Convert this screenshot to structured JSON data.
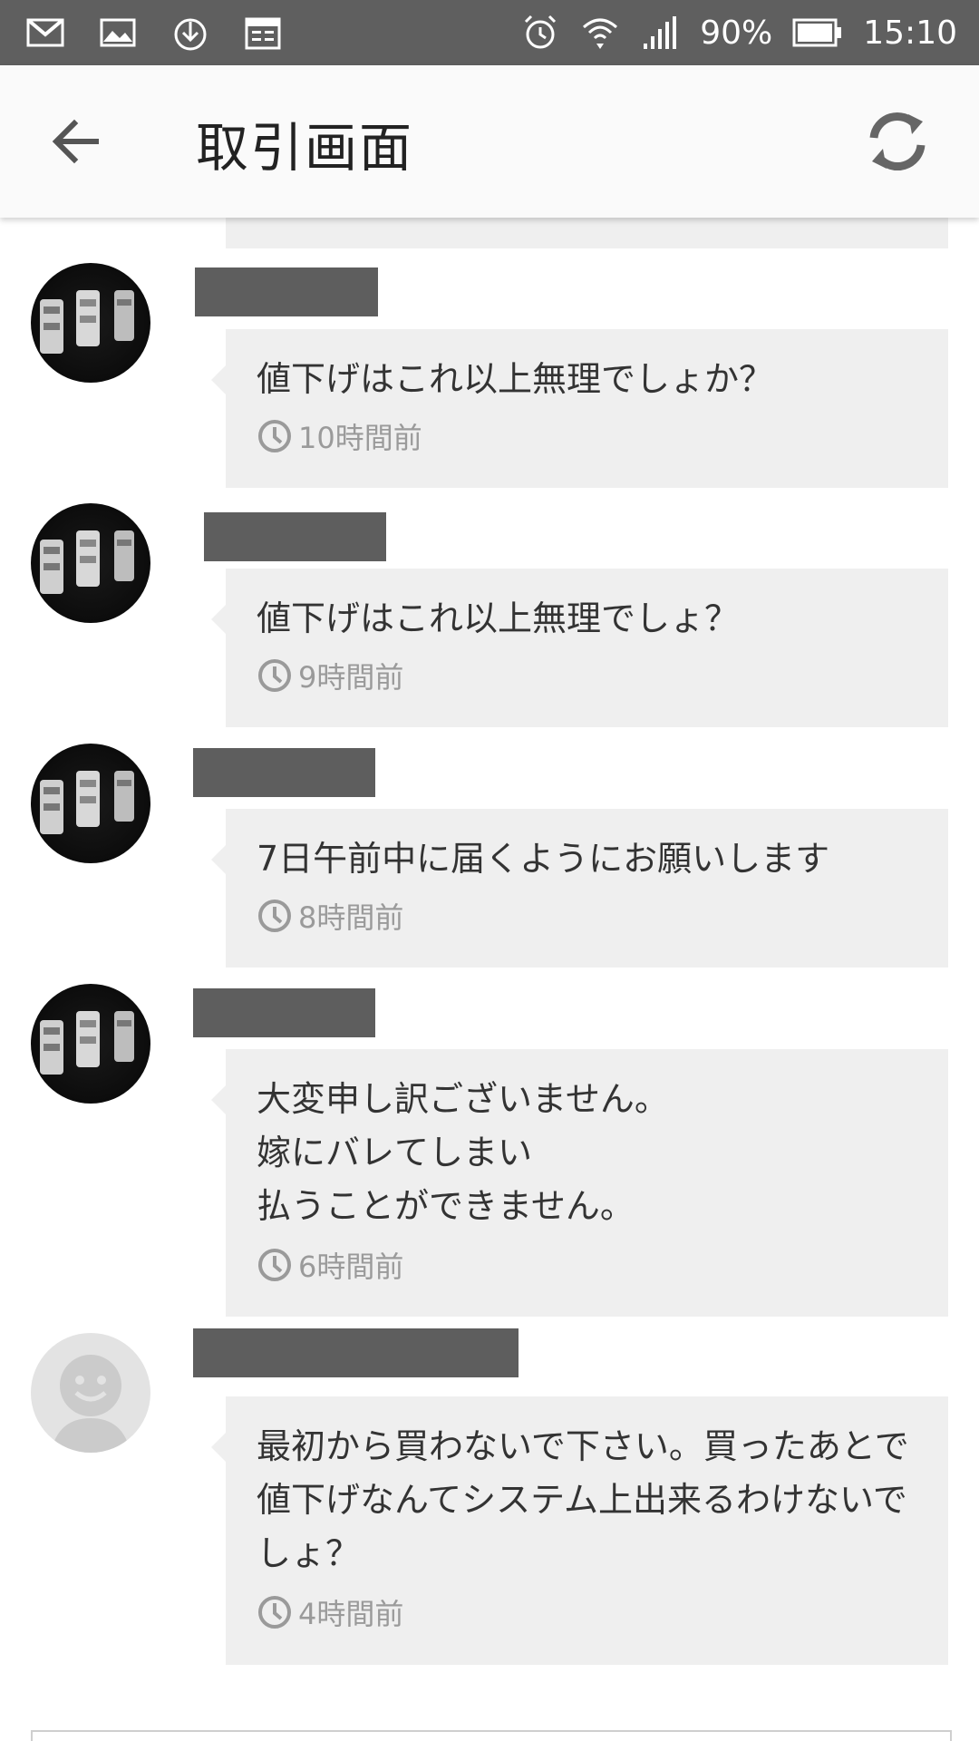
{
  "status_bar": {
    "battery": "90%",
    "time": "15:10",
    "left_icons": [
      "gmail-icon",
      "gallery-icon",
      "download-icon",
      "calendar-icon"
    ],
    "right_icons": [
      "alarm-icon",
      "wifi-icon",
      "signal-icon",
      "battery-icon"
    ]
  },
  "app_bar": {
    "title": "取引画面",
    "back_icon": "arrow-left-icon",
    "refresh_icon": "refresh-icon"
  },
  "messages": [
    {
      "text": "値下げはこれ以上無理でしょか？",
      "time": "10時間前",
      "avatar": "product-photo"
    },
    {
      "text": "値下げはこれ以上無理でしょ？",
      "time": "9時間前",
      "avatar": "product-photo"
    },
    {
      "text": "7日午前中に届くようにお願いします",
      "time": "8時間前",
      "avatar": "product-photo"
    },
    {
      "text": "大変申し訳ございません。\n嫁にバレてしまい\n払うことができません。",
      "time": "6時間前",
      "avatar": "product-photo"
    },
    {
      "text": "最初から買わないで下さい。買ったあとで値下げなんてシステム上出来るわけないでしょ？",
      "time": "4時間前",
      "avatar": "default-user"
    }
  ],
  "colors": {
    "status_bar": "#5f5f5f",
    "app_bar": "#fafafa",
    "bubble": "#efefef",
    "redaction": "#5e5e5e",
    "time_text": "#9a9a9a"
  }
}
